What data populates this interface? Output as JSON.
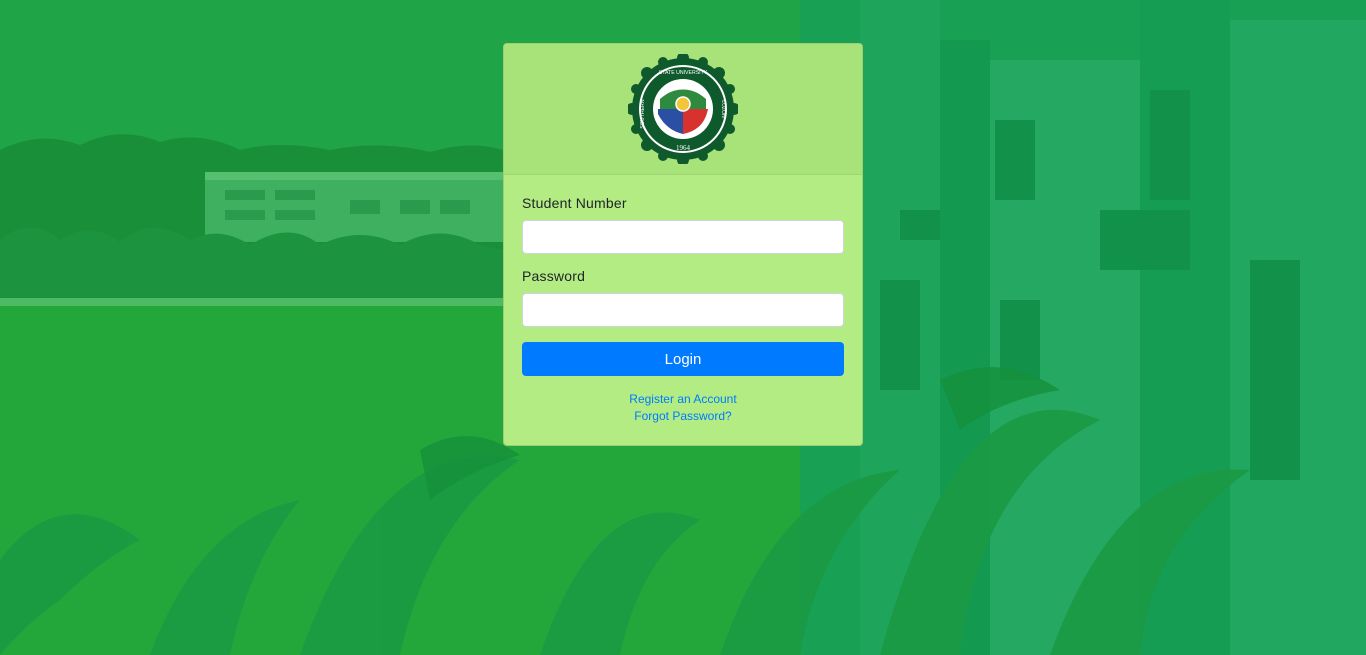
{
  "colors": {
    "background": "#22a542",
    "card": "#b2ec82",
    "card_header": "#a8e37a",
    "primary_button": "#007bff",
    "link": "#007bff"
  },
  "logo": {
    "icon": "university-seal-icon",
    "text_top": "SOUTHERN LUZON STATE UNIVERSITY",
    "year": "1964"
  },
  "form": {
    "student_number_label": "Student Number",
    "student_number_value": "",
    "password_label": "Password",
    "password_value": "",
    "login_label": "Login"
  },
  "links": {
    "register": "Register an Account",
    "forgot": "Forgot Password?"
  }
}
